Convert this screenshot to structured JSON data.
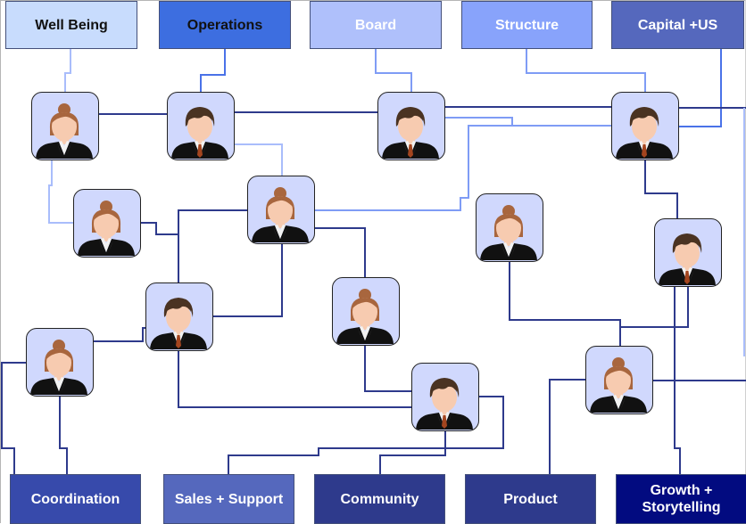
{
  "diagram": {
    "type": "org-network",
    "top_teams": [
      {
        "id": "well-being",
        "label": "Well Being",
        "bg": "#c8dcfd",
        "fg": "#111111"
      },
      {
        "id": "operations",
        "label": "Operations",
        "bg": "#3d6ee0",
        "fg": "#111111"
      },
      {
        "id": "board",
        "label": "Board",
        "bg": "#afc0fb",
        "fg": "#ffffff"
      },
      {
        "id": "structure",
        "label": "Structure",
        "bg": "#88a3fb",
        "fg": "#ffffff"
      },
      {
        "id": "capital-us",
        "label": "Capital +US",
        "bg": "#5568bd",
        "fg": "#ffffff"
      }
    ],
    "bottom_teams": [
      {
        "id": "coordination",
        "label": "Coordination",
        "bg": "#374aab",
        "fg": "#ffffff"
      },
      {
        "id": "sales-support",
        "label": "Sales + Support",
        "bg": "#5568bd",
        "fg": "#ffffff"
      },
      {
        "id": "community",
        "label": "Community",
        "bg": "#2e3a8c",
        "fg": "#ffffff"
      },
      {
        "id": "product",
        "label": "Product",
        "bg": "#2e3a8c",
        "fg": "#ffffff"
      },
      {
        "id": "growth-storytelling",
        "label": "Growth + Storytelling",
        "bg": "#020b80",
        "fg": "#ffffff"
      }
    ],
    "people": [
      {
        "id": "p1",
        "gender": "female"
      },
      {
        "id": "p2",
        "gender": "male"
      },
      {
        "id": "p3",
        "gender": "male"
      },
      {
        "id": "p4",
        "gender": "male"
      },
      {
        "id": "p5",
        "gender": "female"
      },
      {
        "id": "p6",
        "gender": "female"
      },
      {
        "id": "p7",
        "gender": "female"
      },
      {
        "id": "p8",
        "gender": "male"
      },
      {
        "id": "p9",
        "gender": "male"
      },
      {
        "id": "p10",
        "gender": "female"
      },
      {
        "id": "p11",
        "gender": "female"
      },
      {
        "id": "p12",
        "gender": "male"
      },
      {
        "id": "p13",
        "gender": "female"
      }
    ],
    "connector_colors": {
      "light": "#a9bdfb",
      "medium": "#7f9cf5",
      "bright": "#4a72e8",
      "dark": "#2e3a8c"
    },
    "avatar_palette": {
      "bg": "#d0d8fd",
      "skin": "#f7cbb0",
      "female_hair": "#a8663e",
      "male_hair": "#4a3322",
      "suit": "#111111",
      "lapel": "#444444",
      "shirt": "#f2f2f2",
      "tie": "#a4451f"
    }
  }
}
